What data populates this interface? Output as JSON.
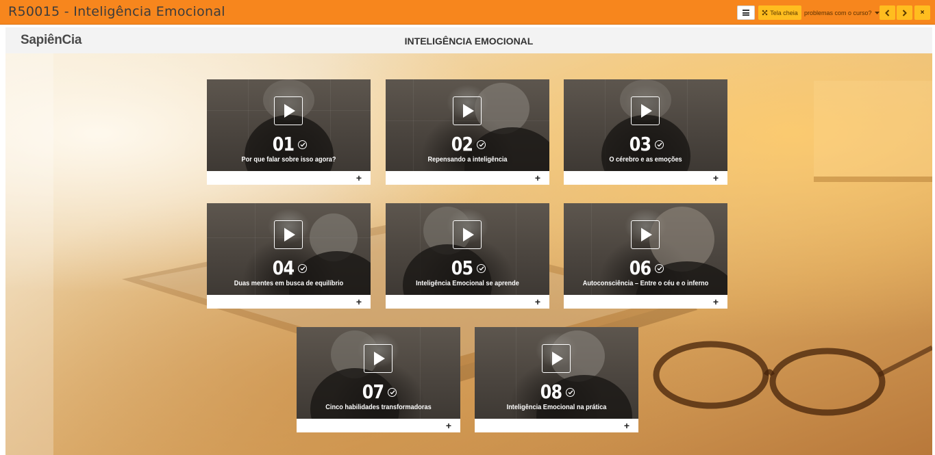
{
  "window": {
    "title": "R50015 - Inteligência Emocional"
  },
  "toolbar": {
    "fullscreen_label": "Tela cheia",
    "problems_label": "problemas com o curso?",
    "prev_symbol": "<",
    "next_symbol": ">",
    "close_symbol": "×",
    "list_icon": "list-icon",
    "expand_icon": "expand-icon",
    "dropdown_icon": "caret-down-icon"
  },
  "header": {
    "logo": "SapiênCia",
    "course_title": "INTELIGÊNCIA EMOCIONAL"
  },
  "lessons": [
    {
      "number": "01",
      "title": "Por que falar sobre isso agora?",
      "completed": true,
      "expand": "+"
    },
    {
      "number": "02",
      "title": "Repensando a inteligência",
      "completed": true,
      "expand": "+"
    },
    {
      "number": "03",
      "title": "O cérebro e as emoções",
      "completed": true,
      "expand": "+"
    },
    {
      "number": "04",
      "title": "Duas mentes em busca de equilíbrio",
      "completed": true,
      "expand": "+"
    },
    {
      "number": "05",
      "title": "Inteligência Emocional se aprende",
      "completed": true,
      "expand": "+"
    },
    {
      "number": "06",
      "title": "Autoconsciência – Entre o céu e o inferno",
      "completed": true,
      "expand": "+"
    },
    {
      "number": "07",
      "title": "Cinco habilidades transformadoras",
      "completed": true,
      "expand": "+"
    },
    {
      "number": "08",
      "title": "Inteligência Emocional na prática",
      "completed": true,
      "expand": "+"
    }
  ],
  "colors": {
    "topbar": "#f7861d",
    "button_accent": "#ffbd1f",
    "header_bg": "#f3f3f3"
  }
}
